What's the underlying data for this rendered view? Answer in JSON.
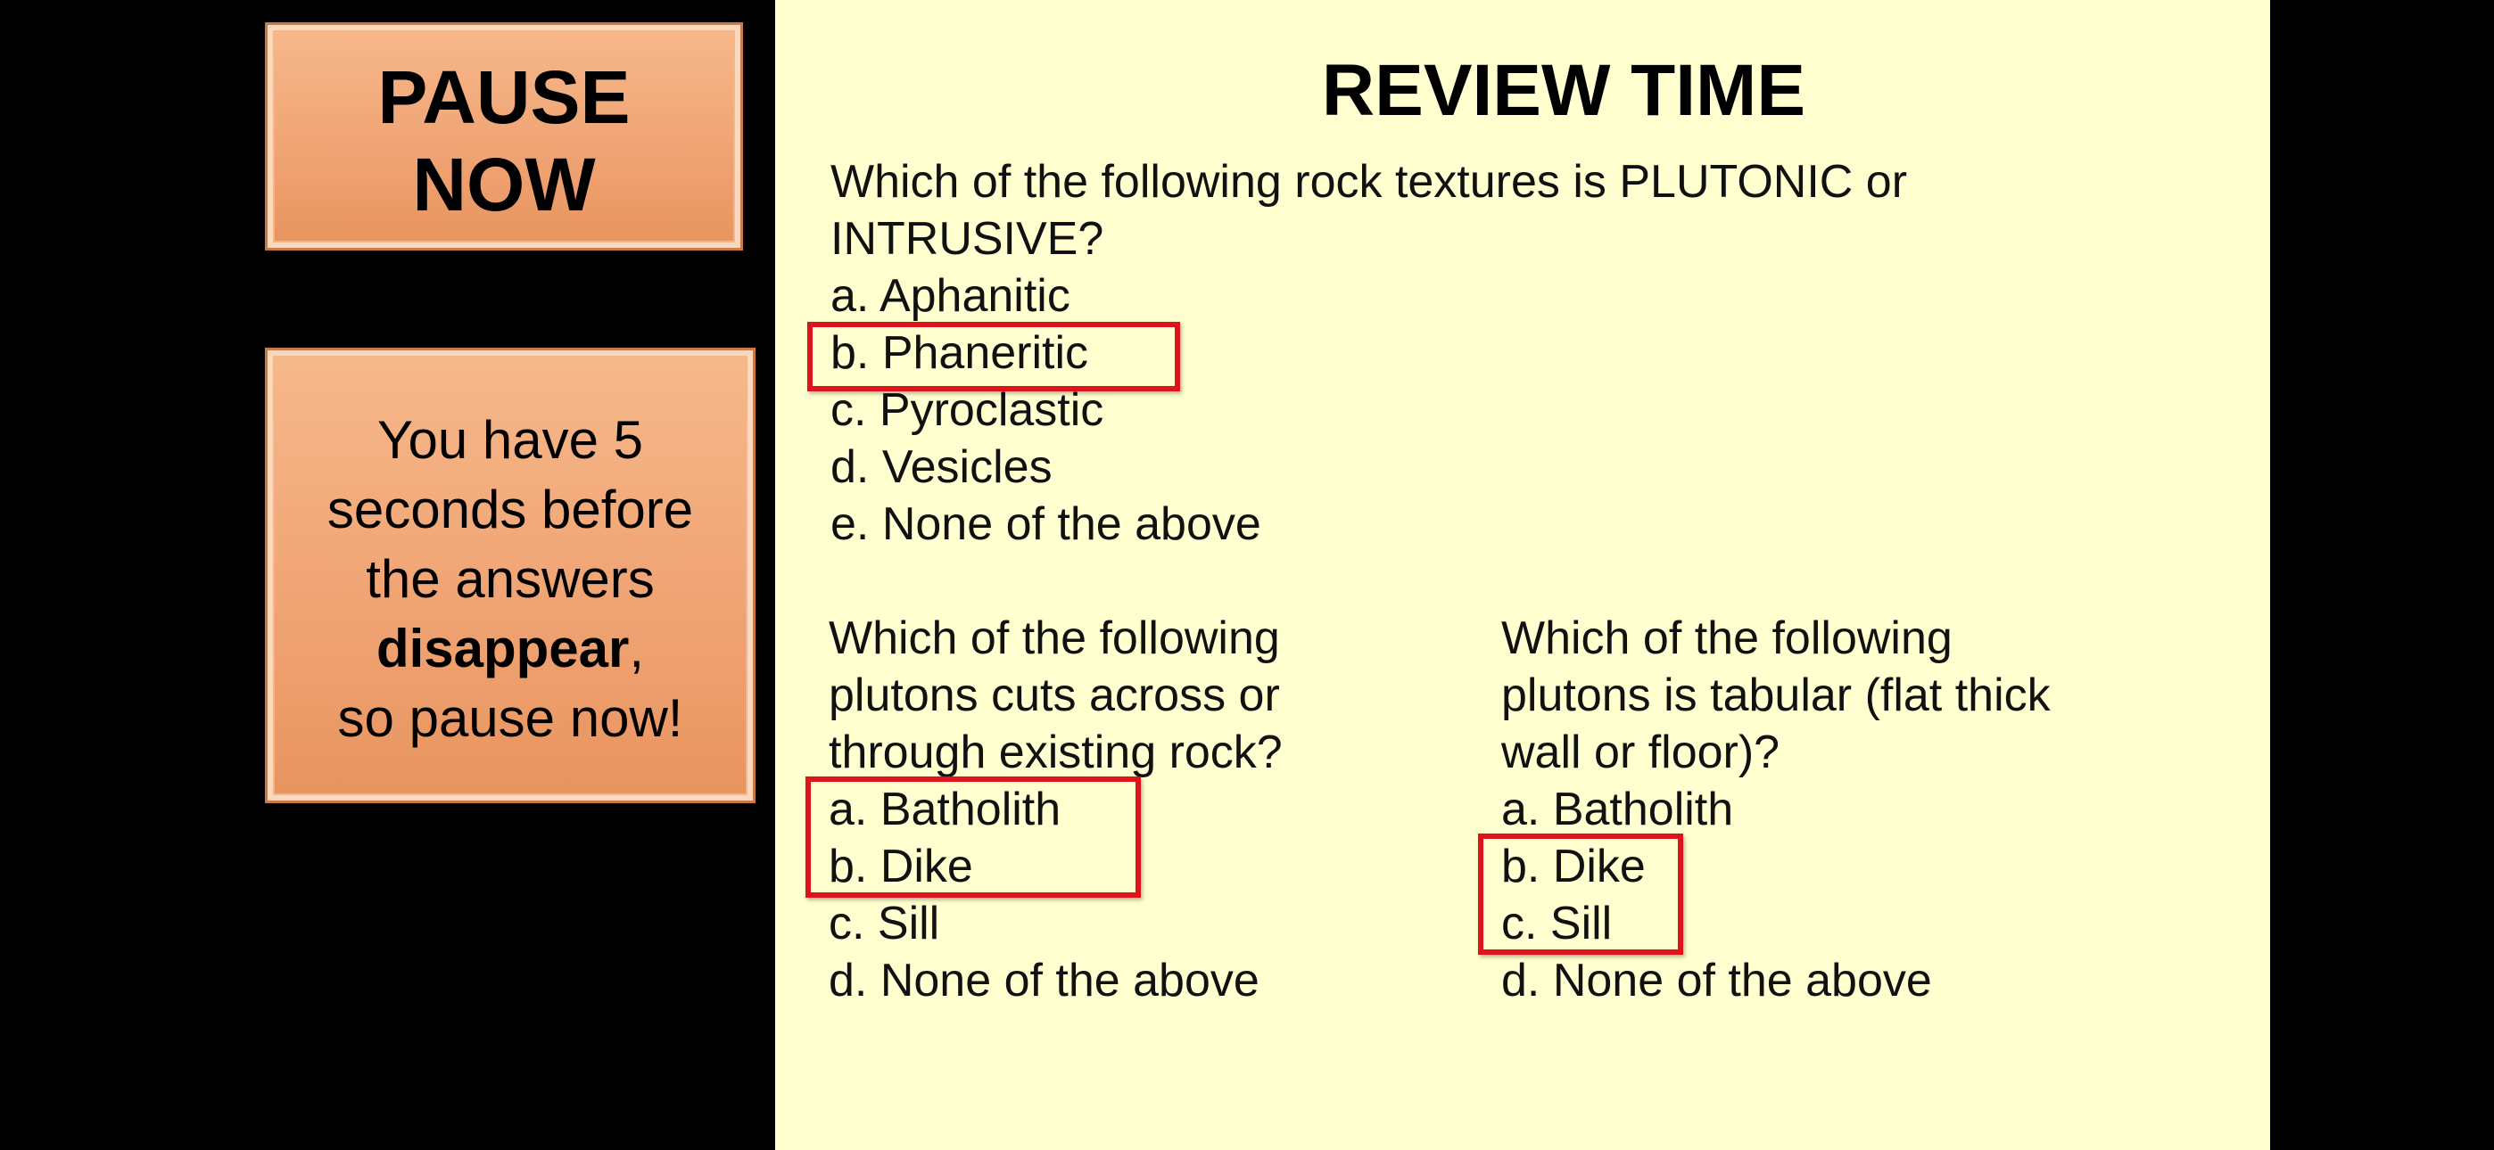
{
  "pause_box": {
    "line1": "PAUSE",
    "line2": "NOW"
  },
  "info_box": {
    "line1": "You have 5",
    "line2": "seconds before",
    "line3": "the answers",
    "line4_bold": "disappear",
    "line4_rest": ",",
    "line5": "so pause now!"
  },
  "slide": {
    "title": "REVIEW TIME",
    "questions": [
      {
        "prompt_lines": [
          "Which of the following rock textures is PLUTONIC or",
          "INTRUSIVE?"
        ],
        "options": [
          "a. Aphanitic",
          "b. Phaneritic",
          "c. Pyroclastic",
          "d. Vesicles",
          "e. None of the above"
        ],
        "highlighted": [
          "b. Phaneritic"
        ]
      },
      {
        "prompt_lines": [
          "Which of the following",
          "plutons cuts across or",
          "through existing rock?"
        ],
        "options": [
          "a. Batholith",
          "b. Dike",
          "c. Sill",
          "d. None of the above"
        ],
        "highlighted": [
          "a. Batholith",
          "b. Dike"
        ]
      },
      {
        "prompt_lines": [
          "Which of the following",
          "plutons is tabular (flat thick",
          "wall or floor)?"
        ],
        "options": [
          "a. Batholith",
          "b. Dike",
          "c. Sill",
          "d. None of the above"
        ],
        "highlighted": [
          "b. Dike",
          "c. Sill"
        ]
      }
    ]
  },
  "colors": {
    "background": "#000000",
    "slide_background": "#ffffcf",
    "box_fill": "#f0a474",
    "highlight_border": "#e0121b"
  }
}
